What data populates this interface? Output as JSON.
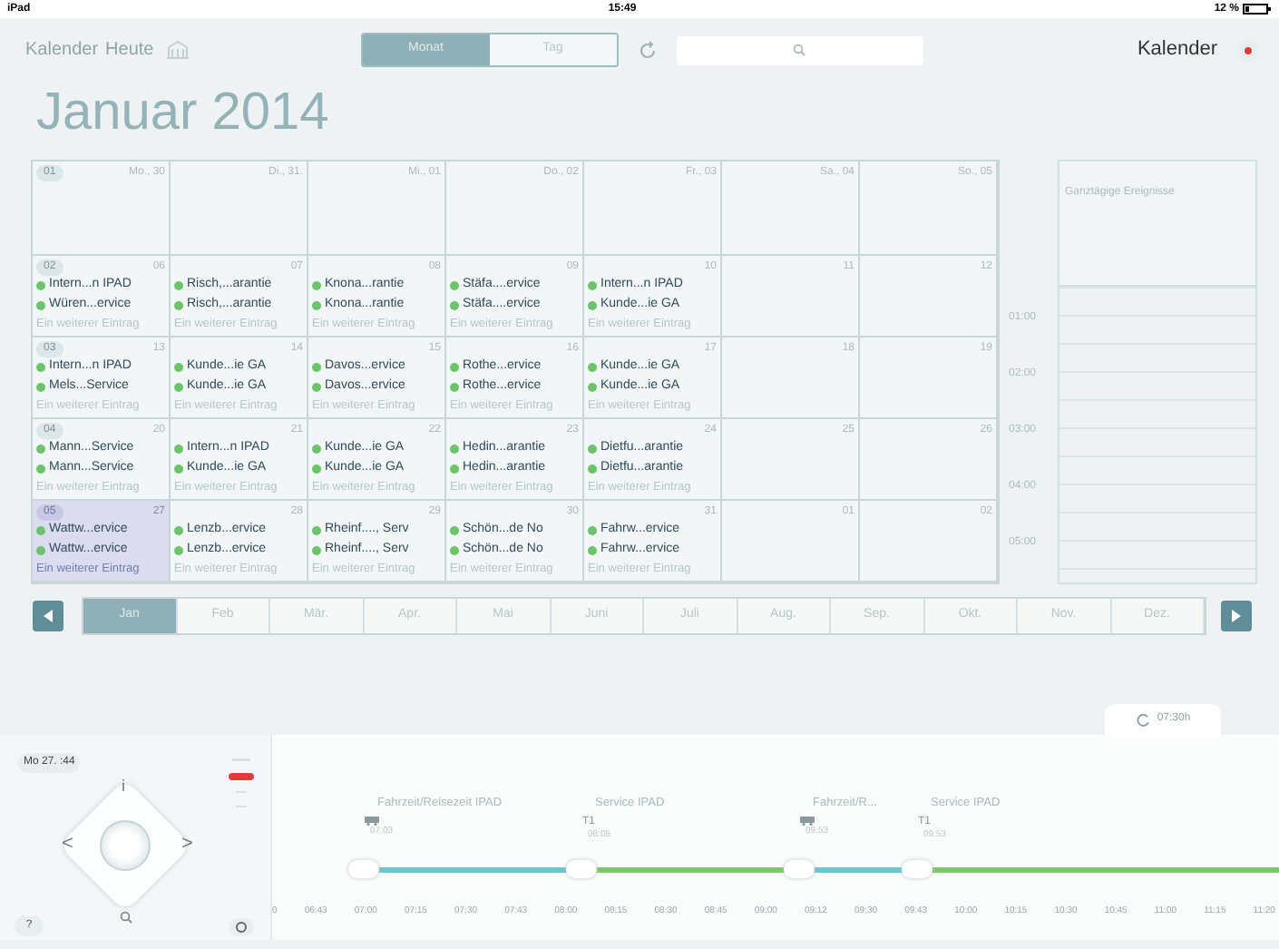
{
  "status_bar": {
    "carrier": "iPad",
    "time": "15:49",
    "battery": "12 %"
  },
  "toolbar": {
    "links": [
      {
        "label": "Kalender"
      },
      {
        "label": "Heute"
      }
    ],
    "view_tabs": [
      {
        "label": "Monat",
        "selected": true
      },
      {
        "label": "Tag",
        "selected": false
      }
    ],
    "calendar_name": "Kalender"
  },
  "month_title": "Januar 2014",
  "calendar": {
    "weeks": [
      {
        "number": "01",
        "days": [
          {
            "label": "Mo., 30",
            "selected": false
          },
          {
            "label": "Di., 31.",
            "selected": false
          },
          {
            "label": "Mi., 01",
            "selected": false
          },
          {
            "label": "Do., 02",
            "selected": false
          },
          {
            "label": "Fr., 03",
            "selected": false
          },
          {
            "label": "Sa., 04",
            "selected": false
          },
          {
            "label": "So., 05",
            "selected": false
          }
        ]
      },
      {
        "number": "02",
        "days": [
          {
            "label": "06",
            "selected": false,
            "events": [
              "Intern...n IPAD",
              "Würen...ervice"
            ],
            "more": "Ein weiterer Eintrag"
          },
          {
            "label": "07",
            "selected": false,
            "events": [
              "Risch,...arantie",
              "Risch,...arantie"
            ],
            "more": "Ein weiterer Eintrag"
          },
          {
            "label": "08",
            "selected": false,
            "events": [
              "Knona...rantie",
              "Knona...rantie"
            ],
            "more": "Ein weiterer Eintrag"
          },
          {
            "label": "09",
            "selected": false,
            "events": [
              "Stäfa....ervice",
              "Stäfa....ervice"
            ],
            "more": "Ein weiterer Eintrag"
          },
          {
            "label": "10",
            "selected": false,
            "events": [
              "Intern...n IPAD",
              "Kunde...ie GA"
            ],
            "more": "Ein weiterer Eintrag"
          },
          {
            "label": "11",
            "selected": false
          },
          {
            "label": "12",
            "selected": false
          }
        ]
      },
      {
        "number": "03",
        "days": [
          {
            "label": "13",
            "selected": false,
            "events": [
              "Intern...n IPAD",
              "Mels...Service"
            ],
            "more": "Ein weiterer Eintrag"
          },
          {
            "label": "14",
            "selected": false,
            "events": [
              "Kunde...ie GA",
              "Kunde...ie GA"
            ],
            "more": "Ein weiterer Eintrag"
          },
          {
            "label": "15",
            "selected": false,
            "events": [
              "Davos...ervice",
              "Davos...ervice"
            ],
            "more": "Ein weiterer Eintrag"
          },
          {
            "label": "16",
            "selected": false,
            "events": [
              "Rothe...ervice",
              "Rothe...ervice"
            ],
            "more": "Ein weiterer Eintrag"
          },
          {
            "label": "17",
            "selected": false,
            "events": [
              "Kunde...ie GA",
              "Kunde...ie GA"
            ],
            "more": "Ein weiterer Eintrag"
          },
          {
            "label": "18",
            "selected": false
          },
          {
            "label": "19",
            "selected": false
          }
        ]
      },
      {
        "number": "04",
        "days": [
          {
            "label": "20",
            "selected": false,
            "events": [
              "Mann...Service",
              "Mann...Service"
            ],
            "more": "Ein weiterer Eintrag"
          },
          {
            "label": "21",
            "selected": false,
            "events": [
              "Intern...n IPAD",
              "Kunde...ie GA"
            ],
            "more": "Ein weiterer Eintrag"
          },
          {
            "label": "22",
            "selected": false,
            "events": [
              "Kunde...ie GA",
              "Kunde...ie GA"
            ],
            "more": "Ein weiterer Eintrag"
          },
          {
            "label": "23",
            "selected": false,
            "events": [
              "Hedin...arantie",
              "Hedin...arantie"
            ],
            "more": "Ein weiterer Eintrag"
          },
          {
            "label": "24",
            "selected": false,
            "events": [
              "Dietfu...arantie",
              "Dietfu...arantie"
            ],
            "more": "Ein weiterer Eintrag"
          },
          {
            "label": "25",
            "selected": false
          },
          {
            "label": "26",
            "selected": false
          }
        ]
      },
      {
        "number": "05",
        "days": [
          {
            "label": "27",
            "selected": true,
            "events": [
              "Wattw...ervice",
              "Wattw...ervice"
            ],
            "more": "Ein weiterer Eintrag"
          },
          {
            "label": "28",
            "selected": false,
            "events": [
              "Lenzb...ervice",
              "Lenzb...ervice"
            ],
            "more": "Ein weiterer Eintrag"
          },
          {
            "label": "29",
            "selected": false,
            "events": [
              "Rheinf...., Serv",
              "Rheinf...., Serv"
            ],
            "more": "Ein weiterer Eintrag"
          },
          {
            "label": "30",
            "selected": false,
            "events": [
              "Schön...de No",
              "Schön...de No"
            ],
            "more": "Ein weiterer Eintrag"
          },
          {
            "label": "31",
            "selected": false,
            "events": [
              "Fahrw...ervice",
              "Fahrw...ervice"
            ],
            "more": "Ein weiterer Eintrag"
          },
          {
            "label": "01",
            "selected": false
          },
          {
            "label": "02",
            "selected": false
          }
        ]
      }
    ]
  },
  "all_day": {
    "title": "Ganztägige Ereignisse",
    "hours": [
      "01:00",
      "02:00",
      "03:00",
      "04:00",
      "05:00"
    ]
  },
  "months": [
    {
      "label": "Jan",
      "selected": true
    },
    {
      "label": "Feb",
      "selected": false
    },
    {
      "label": "Mär.",
      "selected": false
    },
    {
      "label": "Apr.",
      "selected": false
    },
    {
      "label": "Mai",
      "selected": false
    },
    {
      "label": "Juni",
      "selected": false
    },
    {
      "label": "Juli",
      "selected": false
    },
    {
      "label": "Aug.",
      "selected": false
    },
    {
      "label": "Sep.",
      "selected": false
    },
    {
      "label": "Okt.",
      "selected": false
    },
    {
      "label": "Nov.",
      "selected": false
    },
    {
      "label": "Dez.",
      "selected": false
    }
  ],
  "duration_tab": "07:30h",
  "controls": {
    "date_badge": "Mo 27. :44",
    "info": "i",
    "prev": "<",
    "next": ">",
    "help": "?"
  },
  "timeline": {
    "segments": [
      {
        "kind": "idle"
      },
      {
        "kind": "travel",
        "label": "Fahrzeit/Reisezeit IPAD",
        "time": "07:03"
      },
      {
        "kind": "service",
        "label": "Service IPAD",
        "marker": "T1",
        "time": "08:05"
      },
      {
        "kind": "travel",
        "label": "Fahrzeit/R...",
        "time": "09:53"
      },
      {
        "kind": "service",
        "label": "Service IPAD",
        "marker": "T1",
        "time": "09:53"
      }
    ],
    "ticks": [
      "0",
      "06:43",
      "07:00",
      "07:15",
      "07:30",
      "07:43",
      "08:00",
      "08:15",
      "08:30",
      "08:45",
      "09:00",
      "09:12",
      "09:30",
      "09:43",
      "10:00",
      "10:15",
      "10:30",
      "10:45",
      "11:00",
      "11:15",
      "11:20"
    ]
  }
}
